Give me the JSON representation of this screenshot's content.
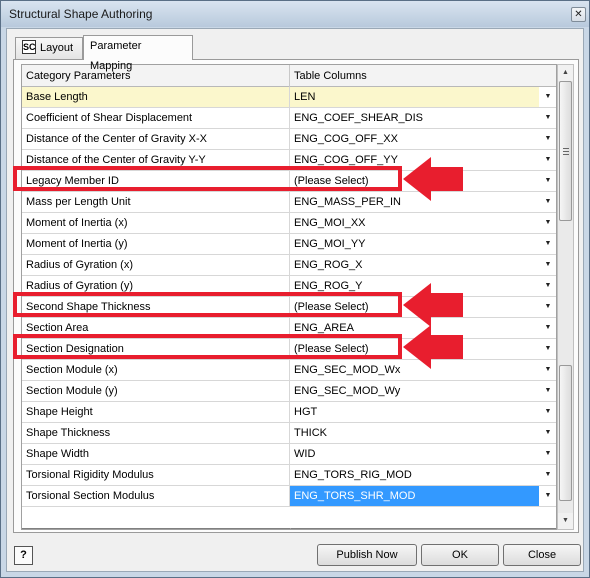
{
  "window": {
    "title": "Structural Shape Authoring",
    "close_glyph": "✕"
  },
  "tabs": [
    {
      "label": "Layout",
      "icon": "structure-icon",
      "icon_glyph": "SC"
    },
    {
      "label": "Parameter Mapping"
    }
  ],
  "grid": {
    "columns": [
      "Category Parameters",
      "Table Columns"
    ],
    "dropdown_glyph": "▼",
    "rows": [
      {
        "parameter": "Base Length",
        "column": "LEN"
      },
      {
        "parameter": "Coefficient of Shear Displacement",
        "column": "ENG_COEF_SHEAR_DIS"
      },
      {
        "parameter": "Distance of the Center of Gravity X-X",
        "column": "ENG_COG_OFF_XX"
      },
      {
        "parameter": "Distance of the Center of Gravity Y-Y",
        "column": "ENG_COG_OFF_YY"
      },
      {
        "parameter": "Legacy Member ID",
        "column": "(Please Select)"
      },
      {
        "parameter": "Mass per Length Unit",
        "column": "ENG_MASS_PER_IN"
      },
      {
        "parameter": "Moment of Inertia (x)",
        "column": "ENG_MOI_XX"
      },
      {
        "parameter": "Moment of Inertia (y)",
        "column": "ENG_MOI_YY"
      },
      {
        "parameter": "Radius of Gyration (x)",
        "column": "ENG_ROG_X"
      },
      {
        "parameter": "Radius of Gyration (y)",
        "column": "ENG_ROG_Y"
      },
      {
        "parameter": "Second Shape Thickness",
        "column": "(Please Select)"
      },
      {
        "parameter": "Section Area",
        "column": "ENG_AREA"
      },
      {
        "parameter": "Section Designation",
        "column": "(Please Select)"
      },
      {
        "parameter": "Section Module (x)",
        "column": "ENG_SEC_MOD_Wx"
      },
      {
        "parameter": "Section Module (y)",
        "column": "ENG_SEC_MOD_Wy"
      },
      {
        "parameter": "Shape Height",
        "column": "HGT"
      },
      {
        "parameter": "Shape Thickness",
        "column": "THICK"
      },
      {
        "parameter": "Shape Width",
        "column": "WID"
      },
      {
        "parameter": "Torsional Rigidity Modulus",
        "column": "ENG_TORS_RIG_MOD"
      },
      {
        "parameter": "Torsional Section Modulus",
        "column": "ENG_TORS_SHR_MOD"
      }
    ]
  },
  "scrollbar": {
    "up_glyph": "▲",
    "down_glyph": "▼"
  },
  "footer": {
    "help_glyph": "?",
    "publish_label": "Publish Now",
    "ok_label": "OK",
    "close_label": "Close"
  },
  "colors": {
    "annotation_red": "#e81e2e",
    "selected_blue": "#3399ff",
    "first_row_yellow": "#fbf7cc"
  }
}
